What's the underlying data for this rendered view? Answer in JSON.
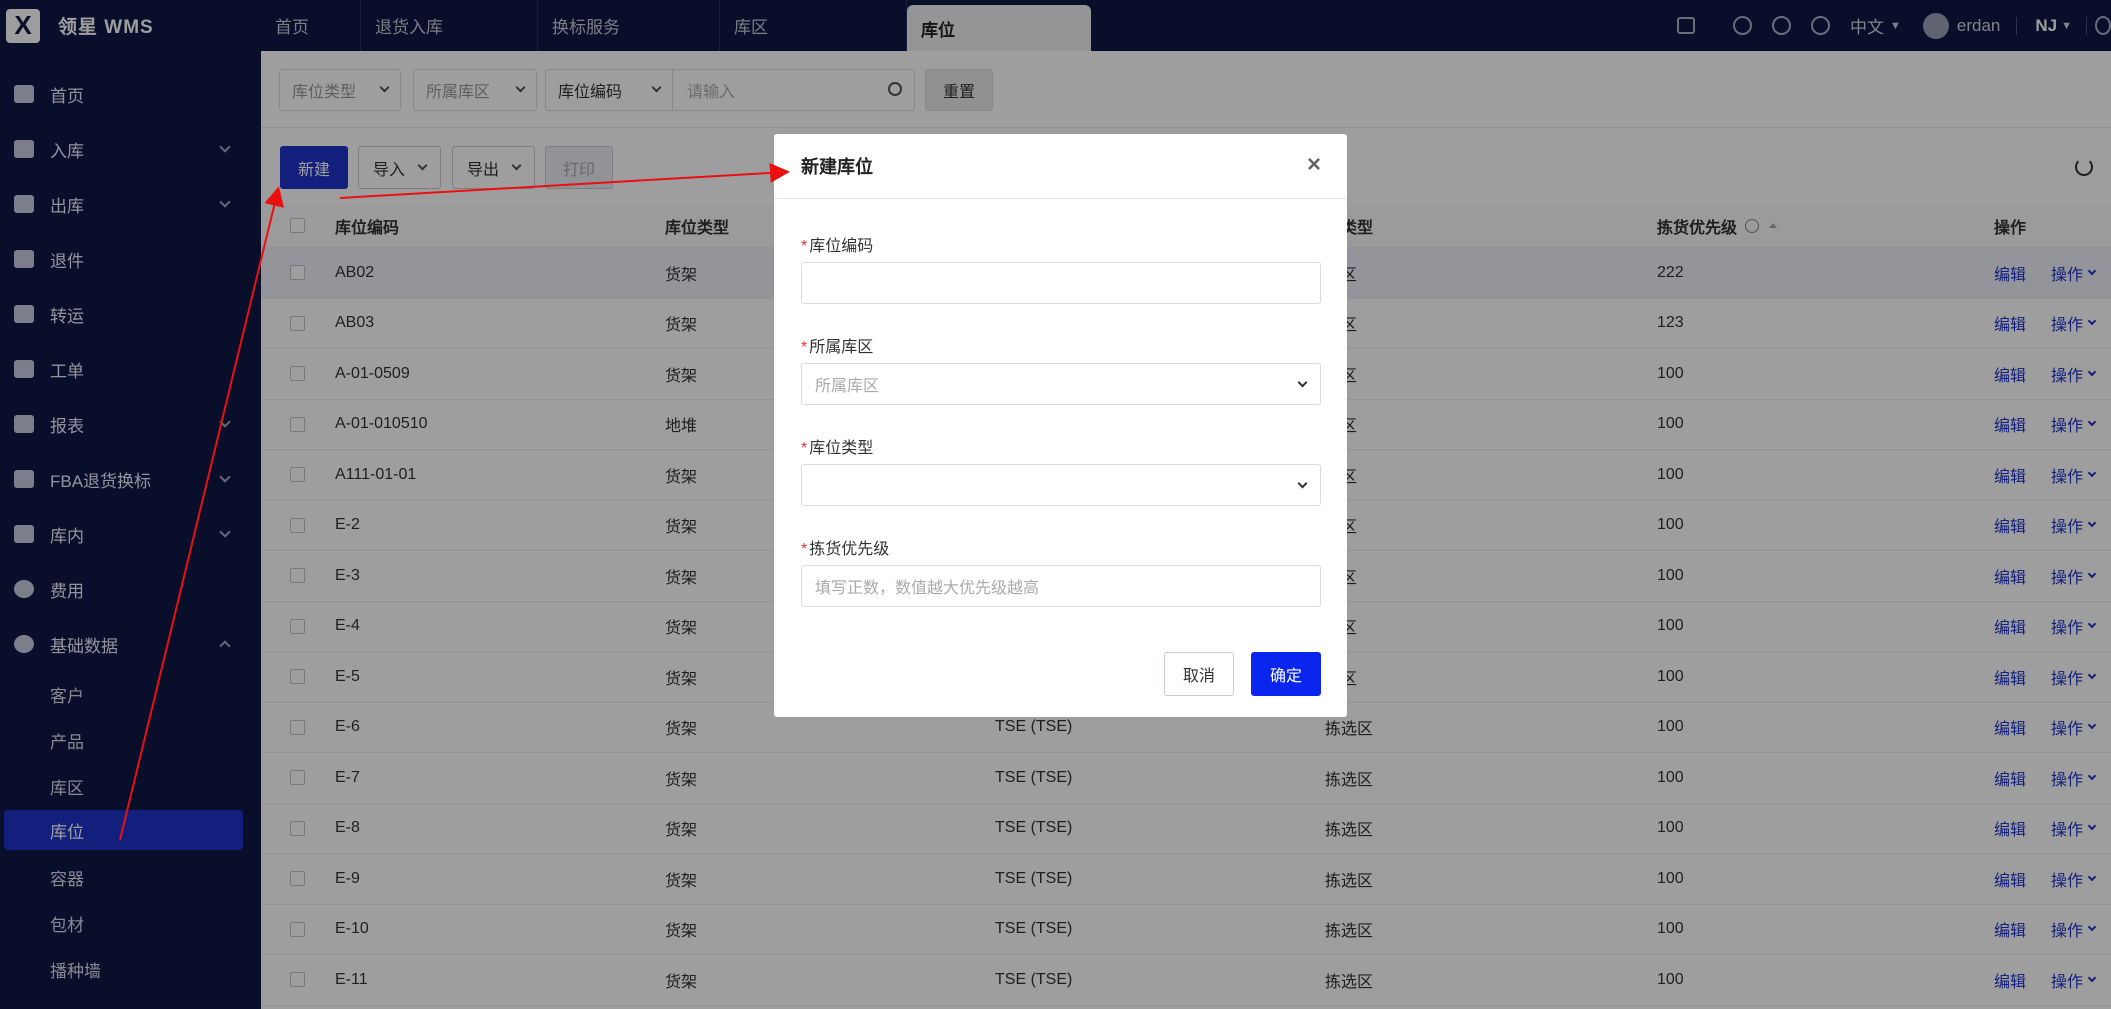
{
  "app": {
    "title": "领星 WMS",
    "logo_letter": "X"
  },
  "tabs": [
    {
      "label": "首页"
    },
    {
      "label": "退货入库"
    },
    {
      "label": "换标服务"
    },
    {
      "label": "库区"
    },
    {
      "label": "库位",
      "active": true
    }
  ],
  "topbar": {
    "language": "中文",
    "user": "erdan",
    "warehouse": "NJ"
  },
  "sidebar": {
    "items": [
      {
        "label": "首页",
        "icon": "home-icon"
      },
      {
        "label": "入库",
        "icon": "inbound-icon",
        "expandable": true
      },
      {
        "label": "出库",
        "icon": "outbound-icon",
        "expandable": true
      },
      {
        "label": "退件",
        "icon": "return-icon"
      },
      {
        "label": "转运",
        "icon": "truck-icon"
      },
      {
        "label": "工单",
        "icon": "workorder-icon"
      },
      {
        "label": "报表",
        "icon": "report-icon",
        "expandable": true
      },
      {
        "label": "FBA退货换标",
        "icon": "fba-return-icon",
        "expandable": true
      },
      {
        "label": "库内",
        "icon": "warehouse-icon",
        "expandable": true
      },
      {
        "label": "费用",
        "icon": "yen-icon"
      },
      {
        "label": "基础数据",
        "icon": "pie-chart-icon",
        "expanded": true
      }
    ],
    "subitems": [
      {
        "label": "客户"
      },
      {
        "label": "产品"
      },
      {
        "label": "库区"
      },
      {
        "label": "库位",
        "active": true
      },
      {
        "label": "容器"
      },
      {
        "label": "包材"
      },
      {
        "label": "播种墙"
      }
    ]
  },
  "filters": {
    "type_placeholder": "库位类型",
    "area_placeholder": "所属库区",
    "field_select": "库位编码",
    "search_placeholder": "请输入",
    "reset_label": "重置"
  },
  "toolbar": {
    "new_label": "新建",
    "import_label": "导入",
    "export_label": "导出",
    "print_label": "打印"
  },
  "table": {
    "columns": [
      "库位编码",
      "库位类型",
      "",
      "区类型",
      "拣货优先级",
      "操作"
    ],
    "edit_label": "编辑",
    "op_label": "操作",
    "rows": [
      {
        "code": "AB02",
        "type": "货架",
        "area": "",
        "area_type": "选区",
        "priority": "222"
      },
      {
        "code": "AB03",
        "type": "货架",
        "area": "",
        "area_type": "选区",
        "priority": "123"
      },
      {
        "code": "A-01-0509",
        "type": "货架",
        "area": "",
        "area_type": "储区",
        "priority": "100"
      },
      {
        "code": "A-01-010510",
        "type": "地堆",
        "area": "",
        "area_type": "选区",
        "priority": "100"
      },
      {
        "code": "A111-01-01",
        "type": "货架",
        "area": "",
        "area_type": "储区",
        "priority": "100"
      },
      {
        "code": "E-2",
        "type": "货架",
        "area": "",
        "area_type": "选区",
        "priority": "100"
      },
      {
        "code": "E-3",
        "type": "货架",
        "area": "",
        "area_type": "选区",
        "priority": "100"
      },
      {
        "code": "E-4",
        "type": "货架",
        "area": "",
        "area_type": "选区",
        "priority": "100"
      },
      {
        "code": "E-5",
        "type": "货架",
        "area": "",
        "area_type": "选区",
        "priority": "100"
      },
      {
        "code": "E-6",
        "type": "货架",
        "area": "TSE (TSE)",
        "area_type": "拣选区",
        "priority": "100"
      },
      {
        "code": "E-7",
        "type": "货架",
        "area": "TSE (TSE)",
        "area_type": "拣选区",
        "priority": "100"
      },
      {
        "code": "E-8",
        "type": "货架",
        "area": "TSE (TSE)",
        "area_type": "拣选区",
        "priority": "100"
      },
      {
        "code": "E-9",
        "type": "货架",
        "area": "TSE (TSE)",
        "area_type": "拣选区",
        "priority": "100"
      },
      {
        "code": "E-10",
        "type": "货架",
        "area": "TSE (TSE)",
        "area_type": "拣选区",
        "priority": "100"
      },
      {
        "code": "E-11",
        "type": "货架",
        "area": "TSE (TSE)",
        "area_type": "拣选区",
        "priority": "100"
      }
    ]
  },
  "modal": {
    "title": "新建库位",
    "close": "×",
    "required_mark": "*",
    "fields": {
      "code_label": "库位编码",
      "code_value": "",
      "area_label": "所属库区",
      "area_placeholder": "所属库区",
      "type_label": "库位类型",
      "type_value": "",
      "priority_label": "拣货优先级",
      "priority_placeholder": "填写正数，数值越大优先级越高"
    },
    "cancel_label": "取消",
    "ok_label": "确定"
  },
  "colors": {
    "brand_dark": "#0f1746",
    "primary": "#1f33c9",
    "confirm": "#0a26ee",
    "annotation_arrow": "#e81010"
  }
}
